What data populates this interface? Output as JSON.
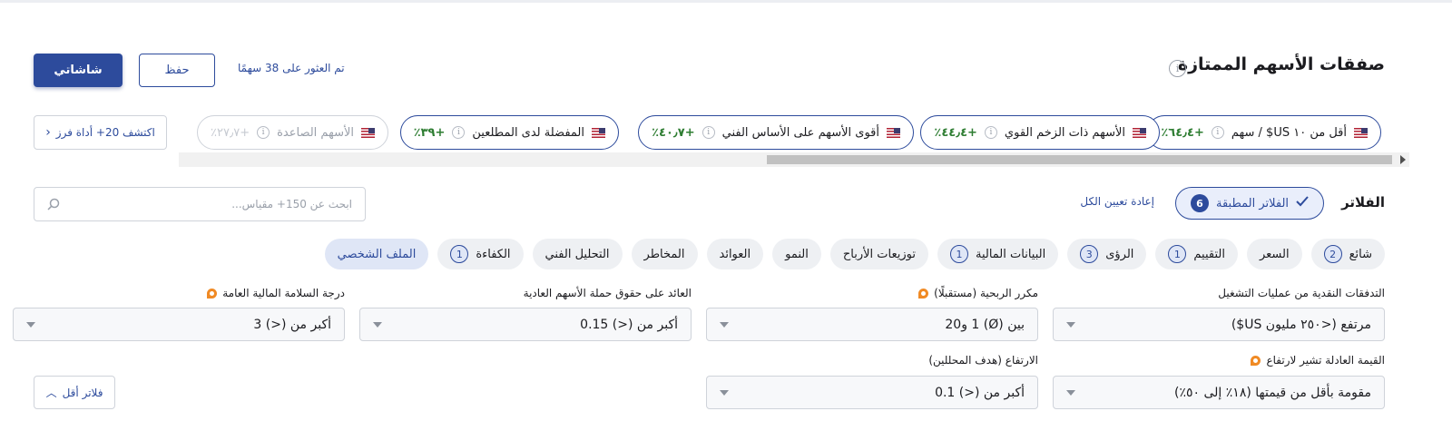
{
  "header": {
    "title": "صفقات الأسهم الممتازة",
    "info_icon": "info-icon",
    "primary_button": "شاشاتي",
    "save_button": "حفظ",
    "found_text": "تم العثور على 38 سهمًا"
  },
  "chips": [
    {
      "label": "أقل من ١٠ US$ / سهم",
      "value": "+٦٤٫٤٪",
      "faded": false
    },
    {
      "label": "الأسهم ذات الزخم القوي",
      "value": "+٤٤٫٤٪",
      "faded": false
    },
    {
      "label": "أقوى الأسهم على الأساس الفني",
      "value": "+٤٠٫٧٪",
      "faded": false
    },
    {
      "label": "المفضلة لدى المطلعين",
      "value": "+٣٩٪",
      "faded": false
    },
    {
      "label": "الأسهم الصاعدة",
      "value": "+٢٧٫٧٪",
      "faded": true
    }
  ],
  "explore_button": "اكتشف 20+ أداة فرز",
  "filters": {
    "label": "الفلاتر",
    "applied_label": "الفلاتر المطبقة",
    "applied_count": "6",
    "reset_all": "إعادة تعيين الكل",
    "search_placeholder": "ابحث عن 150+ مقياس..."
  },
  "tabs": [
    {
      "label": "شائع",
      "badge": "2"
    },
    {
      "label": "السعر",
      "badge": ""
    },
    {
      "label": "التقييم",
      "badge": "1"
    },
    {
      "label": "الرؤى",
      "badge": "3"
    },
    {
      "label": "البيانات المالية",
      "badge": "1"
    },
    {
      "label": "توزيعات الأرباح",
      "badge": ""
    },
    {
      "label": "النمو",
      "badge": ""
    },
    {
      "label": "العوائد",
      "badge": ""
    },
    {
      "label": "المخاطر",
      "badge": ""
    },
    {
      "label": "التحليل الفني",
      "badge": ""
    },
    {
      "label": "الكفاءة",
      "badge": "1"
    },
    {
      "label": "الملف الشخصي",
      "badge": ""
    }
  ],
  "fields": {
    "operating_cash_flow": {
      "label": "التدفقات النقدية من عمليات التشغيل",
      "value": "مرتفع (<٢٥٠ مليون US$)"
    },
    "forward_pe": {
      "label": "مكرر الربحية (مستقبلًا)",
      "value": "بين (Ø) 1 و20"
    },
    "roe": {
      "label": "العائد على حقوق حملة الأسهم العادية",
      "value": "أكبر من (<) 0.15"
    },
    "health_score": {
      "label": "درجة السلامة المالية العامة",
      "value": "أكبر من (<) 3"
    },
    "fair_value_upside": {
      "label": "القيمة العادلة تشير لارتفاع",
      "value": "مقومة بأقل من قيمتها (١٨٪ إلى ٥٠٪)"
    },
    "analyst_upside": {
      "label": "الارتفاع (هدف المحللين)",
      "value": "أكبر من (<) 0.1"
    }
  },
  "less_filters": "فلاتر أقل",
  "colors": {
    "accent": "#2d4b9c",
    "positive": "#2e7d32",
    "pro_badge": "#f08a24"
  }
}
